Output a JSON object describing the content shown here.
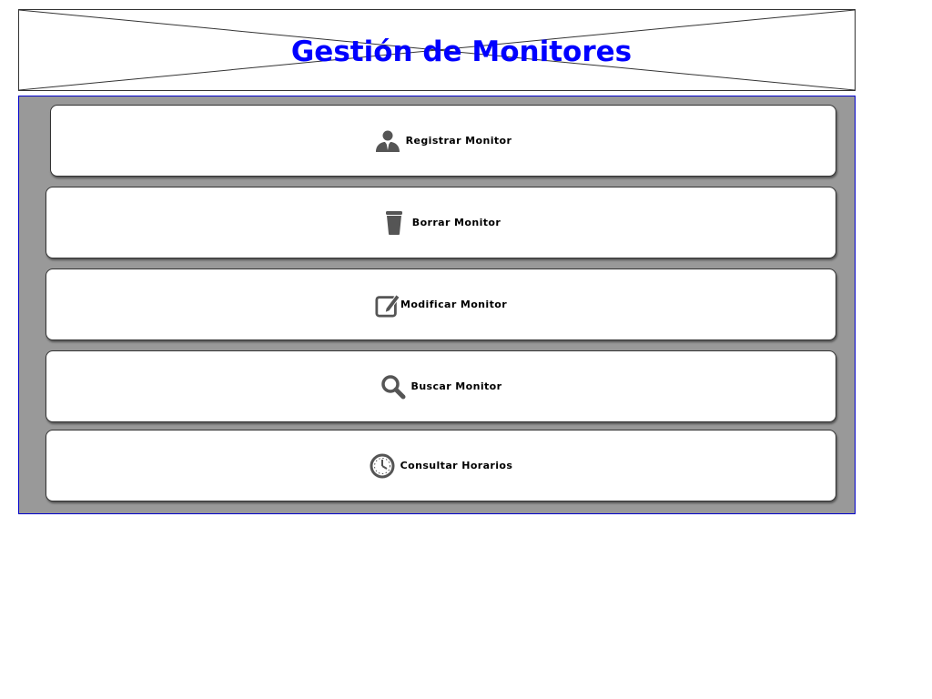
{
  "header": {
    "title": "Gestión de Monitores"
  },
  "menu": {
    "items": [
      {
        "label": "Registrar Monitor",
        "icon": "user-icon"
      },
      {
        "label": "Borrar Monitor",
        "icon": "trash-icon"
      },
      {
        "label": "Modificar Monitor",
        "icon": "edit-icon"
      },
      {
        "label": "Buscar Monitor",
        "icon": "search-icon"
      },
      {
        "label": "Consultar Horarios",
        "icon": "clock-icon"
      }
    ]
  },
  "colors": {
    "title": "#0000ff",
    "panel_background": "#999999",
    "panel_border": "#0000cc",
    "icon": "#555555"
  }
}
